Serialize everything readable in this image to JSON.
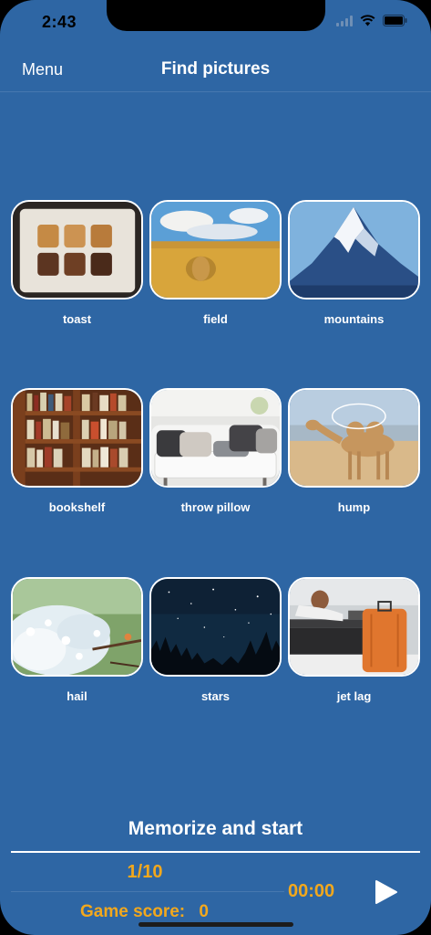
{
  "status_bar": {
    "time": "2:43"
  },
  "nav": {
    "menu_label": "Menu",
    "title": "Find pictures"
  },
  "cards": [
    {
      "label": "toast",
      "image": "toast-image"
    },
    {
      "label": "field",
      "image": "field-image"
    },
    {
      "label": "mountains",
      "image": "mountains-image"
    },
    {
      "label": "bookshelf",
      "image": "bookshelf-image"
    },
    {
      "label": "throw pillow",
      "image": "throw-pillow-image"
    },
    {
      "label": "hump",
      "image": "hump-image"
    },
    {
      "label": "hail",
      "image": "hail-image"
    },
    {
      "label": "stars",
      "image": "stars-image"
    },
    {
      "label": "jet lag",
      "image": "jet-lag-image"
    }
  ],
  "footer": {
    "memorize_label": "Memorize and start",
    "progress": "1/10",
    "timer": "00:00",
    "score_label": "Game score:",
    "score_value": "0"
  },
  "colors": {
    "background": "#2e66a4",
    "accent": "#f2a81d",
    "text": "#ffffff"
  }
}
